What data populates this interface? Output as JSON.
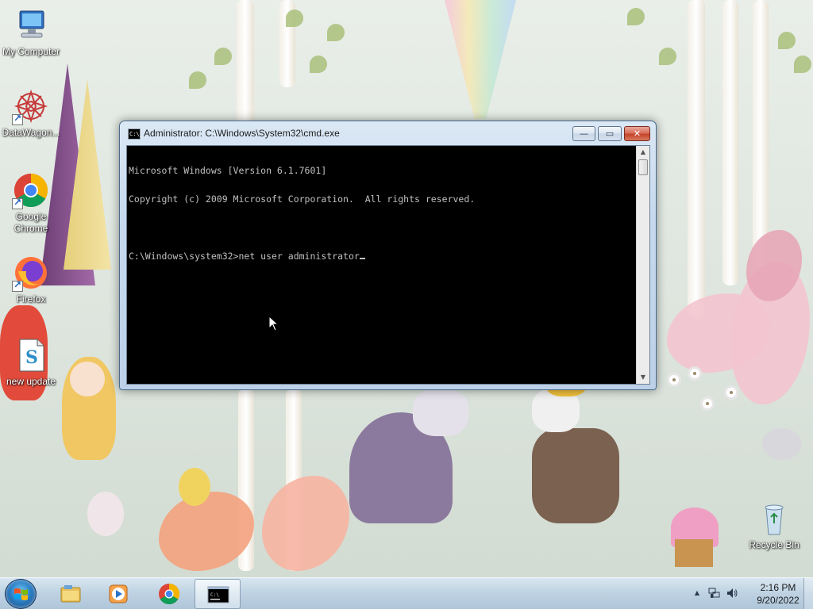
{
  "desktop": {
    "icons": [
      {
        "label": "My Computer",
        "icon": "computer-icon"
      },
      {
        "label": "DataWagon...",
        "icon": "datawagon-icon"
      },
      {
        "label": "Google\nChrome",
        "icon": "chrome-icon"
      },
      {
        "label": "Firefox",
        "icon": "firefox-icon"
      },
      {
        "label": "new update",
        "icon": "script-file-icon"
      },
      {
        "label": "Recycle Bin",
        "icon": "recycle-bin-icon"
      }
    ]
  },
  "cmd_window": {
    "title": "Administrator: C:\\Windows\\System32\\cmd.exe",
    "title_icon_text": "C:\\_",
    "controls": {
      "minimize": "—",
      "maximize": "▭",
      "close": "✕"
    },
    "lines": [
      "Microsoft Windows [Version 6.1.7601]",
      "Copyright (c) 2009 Microsoft Corporation.  All rights reserved.",
      "",
      "C:\\Windows\\system32>net user administrator"
    ]
  },
  "taskbar": {
    "pinned": [
      {
        "name": "explorer",
        "icon": "folder-icon"
      },
      {
        "name": "media-player",
        "icon": "media-player-icon"
      },
      {
        "name": "chrome",
        "icon": "chrome-icon"
      },
      {
        "name": "cmd",
        "icon": "cmd-icon",
        "active": true
      }
    ],
    "tray": {
      "show_hidden": "▲",
      "time": "2:16 PM",
      "date": "9/20/2022"
    }
  },
  "colors": {
    "console_bg": "#000000",
    "console_fg": "#c0c0c0",
    "close_button": "#c4442b"
  }
}
